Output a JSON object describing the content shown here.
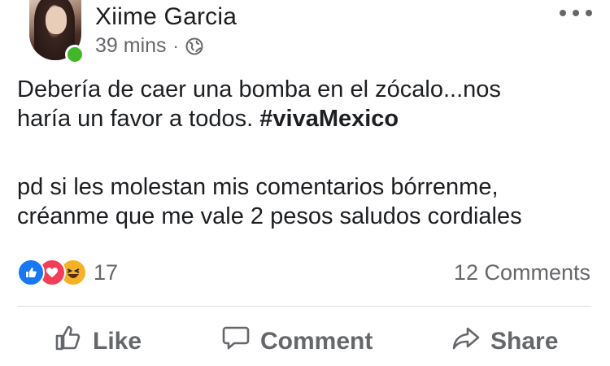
{
  "post": {
    "author": {
      "name": "Xiime Garcia",
      "online": true,
      "avatar_icon": "profile-photo"
    },
    "timestamp": "39 mins",
    "separator": "·",
    "privacy_icon": "globe-icon",
    "text": {
      "line1": "Debería de caer una bomba en el zócalo...nos",
      "line2_prefix": "haría un favor a todos. ",
      "hashtag": "#vivaMexico",
      "line3": "pd si les molestan mis comentarios bórrenme,",
      "line4": "créanme que me vale 2 pesos  saludos cordiales"
    },
    "reactions": {
      "icons": [
        "like-icon",
        "love-icon",
        "haha-icon"
      ],
      "count": "17"
    },
    "comments_count": "12 Comments",
    "actions": {
      "like": "Like",
      "comment": "Comment",
      "share": "Share"
    }
  },
  "colors": {
    "text": "#1c1e21",
    "secondary": "#65676b",
    "online": "#42b72a",
    "like": "#1877f2",
    "love": "#f33e58",
    "haha": "#f7b125",
    "divider": "#dadde1"
  }
}
